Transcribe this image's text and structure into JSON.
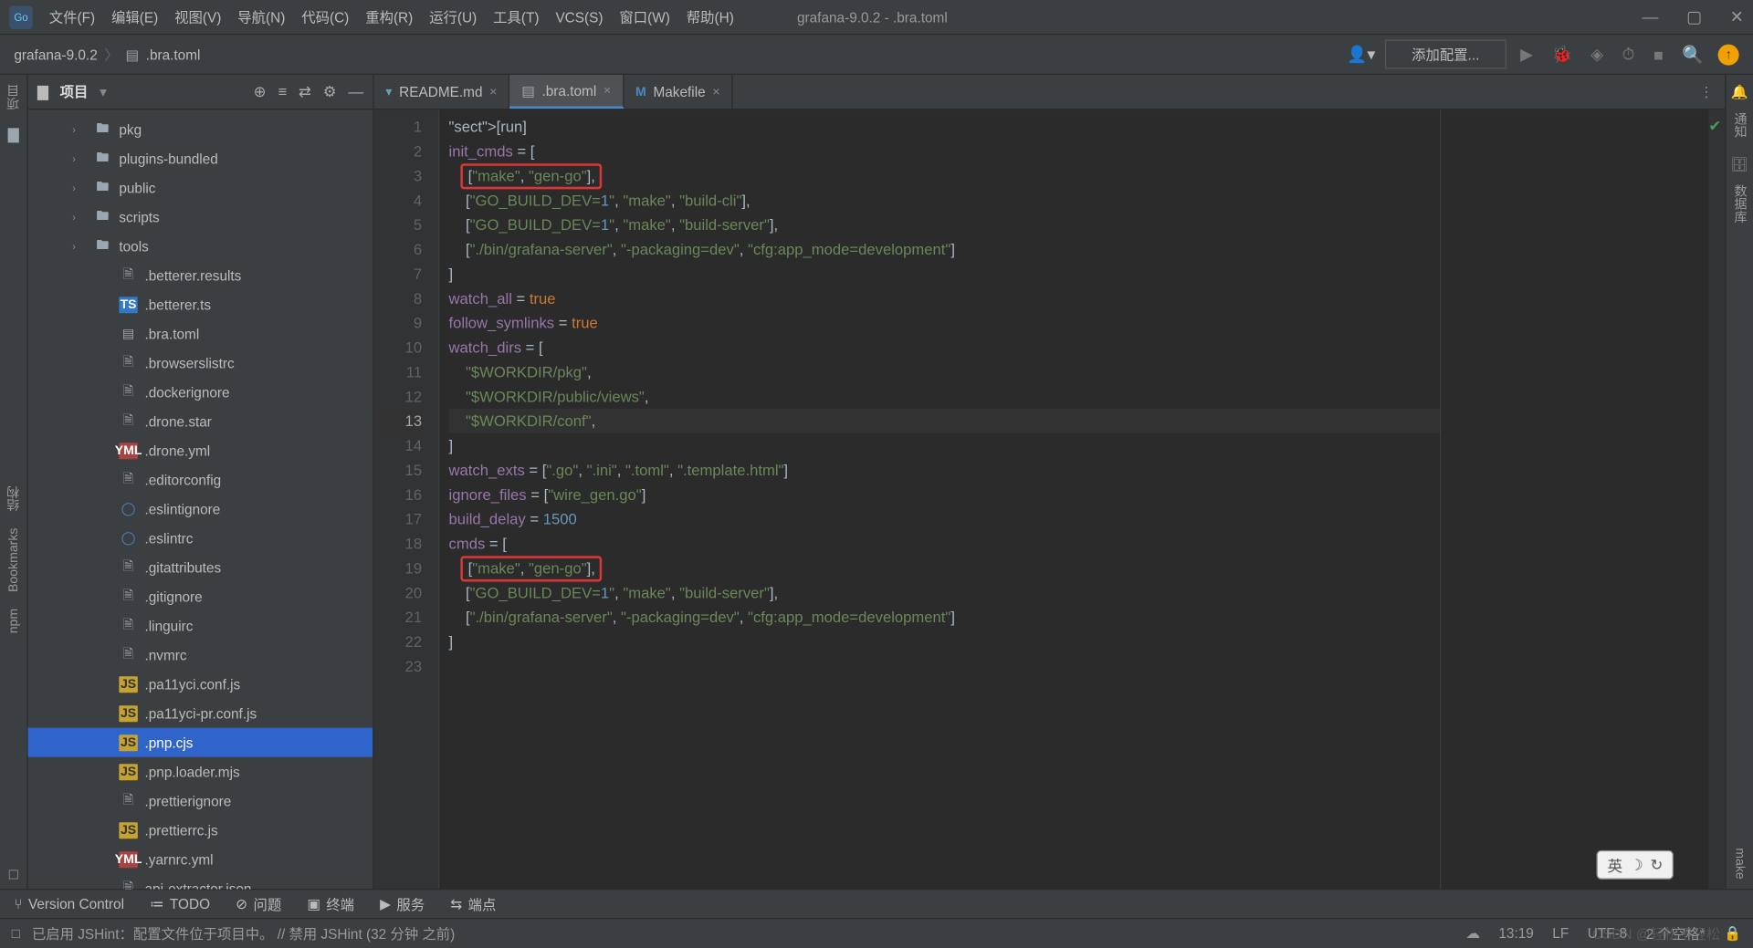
{
  "window_title": "grafana-9.0.2 - .bra.toml",
  "menus": [
    "文件(F)",
    "编辑(E)",
    "视图(V)",
    "导航(N)",
    "代码(C)",
    "重构(R)",
    "运行(U)",
    "工具(T)",
    "VCS(S)",
    "窗口(W)",
    "帮助(H)"
  ],
  "breadcrumb": {
    "root": "grafana-9.0.2",
    "file": ".bra.toml"
  },
  "toolbar": {
    "add_config": "添加配置...",
    "user_count": ""
  },
  "project": {
    "panel_label": "项目",
    "sidebar_label": "项目",
    "folders": [
      "pkg",
      "plugins-bundled",
      "public",
      "scripts",
      "tools"
    ],
    "files": [
      {
        "name": ".betterer.results",
        "icon": "file"
      },
      {
        "name": ".betterer.ts",
        "icon": "ts"
      },
      {
        "name": ".bra.toml",
        "icon": "toml"
      },
      {
        "name": ".browserslistrc",
        "icon": "file"
      },
      {
        "name": ".dockerignore",
        "icon": "file"
      },
      {
        "name": ".drone.star",
        "icon": "file"
      },
      {
        "name": ".drone.yml",
        "icon": "yaml"
      },
      {
        "name": ".editorconfig",
        "icon": "file"
      },
      {
        "name": ".eslintignore",
        "icon": "circ"
      },
      {
        "name": ".eslintrc",
        "icon": "circ"
      },
      {
        "name": ".gitattributes",
        "icon": "file"
      },
      {
        "name": ".gitignore",
        "icon": "file"
      },
      {
        "name": ".linguirc",
        "icon": "file"
      },
      {
        "name": ".nvmrc",
        "icon": "file"
      },
      {
        "name": ".pa11yci.conf.js",
        "icon": "js"
      },
      {
        "name": ".pa11yci-pr.conf.js",
        "icon": "js"
      },
      {
        "name": ".pnp.cjs",
        "icon": "js",
        "selected": true
      },
      {
        "name": ".pnp.loader.mjs",
        "icon": "js"
      },
      {
        "name": ".prettierignore",
        "icon": "file"
      },
      {
        "name": ".prettierrc.js",
        "icon": "js"
      },
      {
        "name": ".yarnrc.yml",
        "icon": "yaml"
      },
      {
        "name": "api-extractor.json",
        "icon": "file"
      }
    ]
  },
  "tabs": [
    {
      "label": "README.md",
      "icon": "md"
    },
    {
      "label": ".bra.toml",
      "icon": "toml",
      "active": true
    },
    {
      "label": "Makefile",
      "icon": "m"
    }
  ],
  "code": {
    "lines": [
      {
        "n": 1,
        "raw": "[run]",
        "cls": "sect"
      },
      {
        "n": 2,
        "raw": "init_cmds = ["
      },
      {
        "n": 3,
        "raw": "    [\"make\", \"gen-go\"],",
        "hl": true
      },
      {
        "n": 4,
        "raw": "    [\"GO_BUILD_DEV=1\", \"make\", \"build-cli\"],"
      },
      {
        "n": 5,
        "raw": "    [\"GO_BUILD_DEV=1\", \"make\", \"build-server\"],"
      },
      {
        "n": 6,
        "raw": "    [\"./bin/grafana-server\", \"-packaging=dev\", \"cfg:app_mode=development\"]"
      },
      {
        "n": 7,
        "raw": "]"
      },
      {
        "n": 8,
        "raw": "watch_all = true"
      },
      {
        "n": 9,
        "raw": "follow_symlinks = true"
      },
      {
        "n": 10,
        "raw": "watch_dirs = ["
      },
      {
        "n": 11,
        "raw": "    \"$WORKDIR/pkg\","
      },
      {
        "n": 12,
        "raw": "    \"$WORKDIR/public/views\","
      },
      {
        "n": 13,
        "raw": "    \"$WORKDIR/conf\",",
        "cur": true
      },
      {
        "n": 14,
        "raw": "]"
      },
      {
        "n": 15,
        "raw": "watch_exts = [\".go\", \".ini\", \".toml\", \".template.html\"]"
      },
      {
        "n": 16,
        "raw": "ignore_files = [\"wire_gen.go\"]"
      },
      {
        "n": 17,
        "raw": "build_delay = 1500"
      },
      {
        "n": 18,
        "raw": "cmds = ["
      },
      {
        "n": 19,
        "raw": "    [\"make\", \"gen-go\"],",
        "hl": true
      },
      {
        "n": 20,
        "raw": "    [\"GO_BUILD_DEV=1\", \"make\", \"build-server\"],"
      },
      {
        "n": 21,
        "raw": "    [\"./bin/grafana-server\", \"-packaging=dev\", \"cfg:app_mode=development\"]"
      },
      {
        "n": 22,
        "raw": "]"
      },
      {
        "n": 23,
        "raw": ""
      }
    ]
  },
  "right_sidebar": {
    "notify": "通知",
    "db": "数据库",
    "make": "make"
  },
  "left_sidebar": {
    "structure": "结构",
    "bookmarks": "Bookmarks",
    "npm": "npm"
  },
  "tool_windows": [
    "Version Control",
    "TODO",
    "问题",
    "终端",
    "服务",
    "端点"
  ],
  "status": {
    "left_icon": "□",
    "hint": "已启用 JSHint：配置文件位于项目中。 // 禁用 JSHint (32 分钟 之前)",
    "time": "13:19",
    "line_sep": "LF",
    "encoding": "UTF-8",
    "indent": "2 个空格*",
    "branch": "",
    "watermark": "CSDN @轻松不轻松"
  },
  "ime": {
    "lang": "英"
  }
}
